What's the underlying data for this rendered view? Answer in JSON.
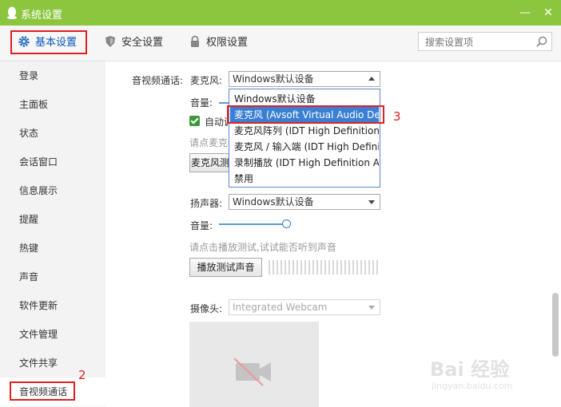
{
  "window": {
    "title": "系统设置",
    "minimize_glyph": "—",
    "close_glyph": "✕"
  },
  "toolbar": {
    "tabs": [
      {
        "label": "基本设置",
        "icon": "gear-icon"
      },
      {
        "label": "安全设置",
        "icon": "shield-icon"
      },
      {
        "label": "权限设置",
        "icon": "lock-icon"
      }
    ],
    "search_placeholder": "搜索设置项"
  },
  "sidebar": {
    "items": [
      {
        "label": "登录"
      },
      {
        "label": "主面板"
      },
      {
        "label": "状态"
      },
      {
        "label": "会话窗口"
      },
      {
        "label": "信息展示"
      },
      {
        "label": "提醒"
      },
      {
        "label": "热键"
      },
      {
        "label": "声音"
      },
      {
        "label": "软件更新"
      },
      {
        "label": "文件管理"
      },
      {
        "label": "文件共享"
      },
      {
        "label": "音视频通话"
      }
    ],
    "active": "音视频通话"
  },
  "annotations": {
    "a1": "1",
    "a2": "2",
    "a3": "3"
  },
  "av": {
    "section_label": "音视频通话:",
    "mic_label": "麦克风:",
    "mic_selected": "Windows默认设备",
    "volume_label": "音量:",
    "auto_label": "自动调",
    "mic_hint": "请点麦克",
    "mic_test_button": "麦克风测",
    "mic_options": [
      "Windows默认设备",
      "麦克风 (Avsoft Virtual Audio Device)",
      "麦克风阵列 (IDT High Definition Audi",
      "麦克风 / 输入端 (IDT High Definition",
      "录制播放 (IDT High Definition Audio",
      "禁用"
    ],
    "highlighted_option": "麦克风 (Avsoft Virtual Audio Device)",
    "speaker_label": "扬声器:",
    "speaker_selected": "Windows默认设备",
    "speaker_volume_label": "音量:",
    "speaker_volume_level": 0.86,
    "speaker_hint": "请点击播放测试,试试能否听到声音",
    "speaker_test_button": "播放测试声音",
    "camera_label": "摄像头:",
    "camera_selected": "Integrated Webcam"
  },
  "watermark": {
    "brand": "Bai 经验",
    "url": "jingyan.baidu.com"
  },
  "colors": {
    "titlebar": "#8cc63f",
    "selection": "#3b7fd4",
    "annotation_red": "#e02020"
  }
}
